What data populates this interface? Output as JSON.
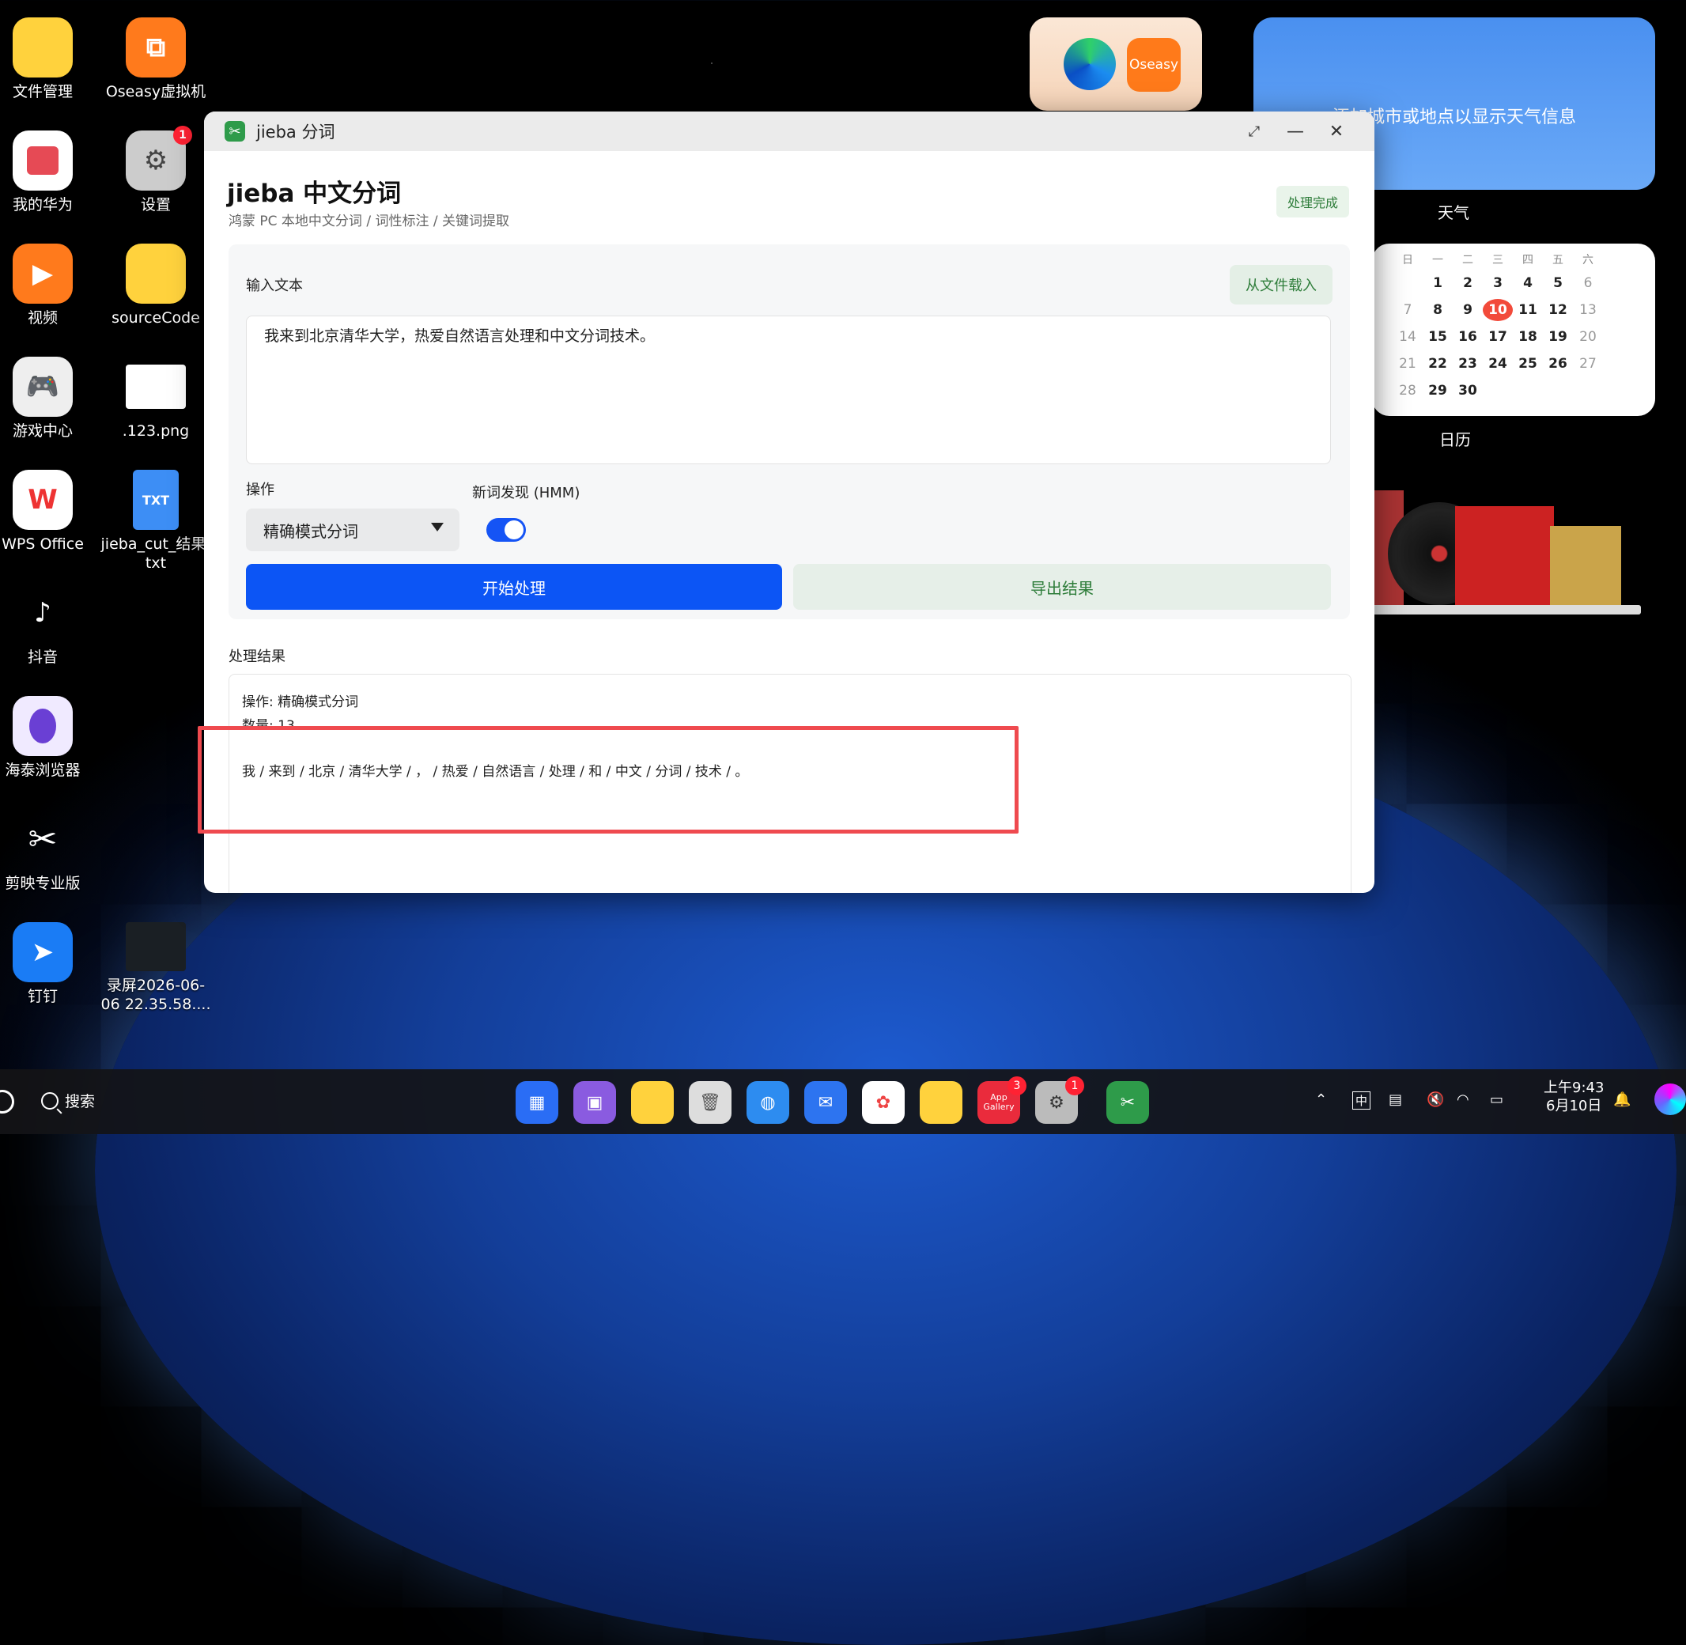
{
  "desktop": {
    "icons_col1": [
      {
        "label": "文件管理",
        "icon": "folder-icon"
      },
      {
        "label": "我的华为",
        "icon": "huawei-icon"
      },
      {
        "label": "视频",
        "icon": "video-icon"
      },
      {
        "label": "游戏中心",
        "icon": "gamepad-icon"
      },
      {
        "label": "WPS Office",
        "icon": "wps-icon"
      },
      {
        "label": "抖音",
        "icon": "douyin-icon"
      },
      {
        "label": "海泰浏览器",
        "icon": "browser-icon"
      },
      {
        "label": "剪映专业版",
        "icon": "capcut-icon"
      },
      {
        "label": "钉钉",
        "icon": "dingtalk-icon"
      }
    ],
    "icons_col2": [
      {
        "label": "Oseasy虚拟机",
        "icon": "vm-icon"
      },
      {
        "label": "设置",
        "icon": "settings-icon",
        "badge": "1"
      },
      {
        "label": "sourceCode",
        "icon": "folder-icon"
      },
      {
        "label": ".123.png",
        "icon": "image-file-icon"
      },
      {
        "label": "jieba_cut_结果.txt",
        "icon": "txt-file-icon",
        "badge_text": "TXT"
      },
      {
        "label": "录屏2026-06-06 22.35.58....",
        "icon": "video-file-icon"
      }
    ]
  },
  "widgets": {
    "oseasy_label": "Oseasy",
    "weather": {
      "message": "添加城市或地点以显示天气信息",
      "label": "天气"
    },
    "calendar": {
      "label": "日历",
      "weekdays": [
        "日",
        "一",
        "二",
        "三",
        "四",
        "五",
        "六"
      ],
      "days": [
        "",
        "1",
        "2",
        "3",
        "4",
        "5",
        "6",
        "7",
        "8",
        "9",
        "10",
        "11",
        "12",
        "13",
        "14",
        "15",
        "16",
        "17",
        "18",
        "19",
        "20",
        "21",
        "22",
        "23",
        "24",
        "25",
        "26",
        "27",
        "28",
        "29",
        "30"
      ],
      "today": "10"
    }
  },
  "window": {
    "title": "jieba 分词",
    "heading": "jieba 中文分词",
    "subtitle": "鸿蒙 PC 本地中文分词 / 词性标注 / 关键词提取",
    "status_badge": "处理完成",
    "input_label": "输入文本",
    "load_button": "从文件载入",
    "input_text": "我来到北京清华大学，热爱自然语言处理和中文分词技术。",
    "operation_label": "操作",
    "operation_value": "精确模式分词",
    "hmm_label": "新词发现 (HMM)",
    "hmm_enabled": true,
    "start_button": "开始处理",
    "export_button": "导出结果",
    "results_label": "处理结果",
    "result_operation": "操作: 精确模式分词",
    "result_count": "数量: 13",
    "result_tokens": "我 / 来到 / 北京 / 清华大学 / ， / 热爱 / 自然语言 / 处理 / 和 / 中文 / 分词 / 技术 / 。"
  },
  "taskbar": {
    "search_label": "搜索",
    "app_gallery_label": "App Gallery",
    "app_gallery_badge": "3",
    "settings_badge": "1",
    "ime": "中",
    "time": "上午9:43",
    "date": "6月10日"
  },
  "colors": {
    "accent": "#0c55f5",
    "success": "#2e7d3a",
    "highlight": "#ef4a4f"
  }
}
